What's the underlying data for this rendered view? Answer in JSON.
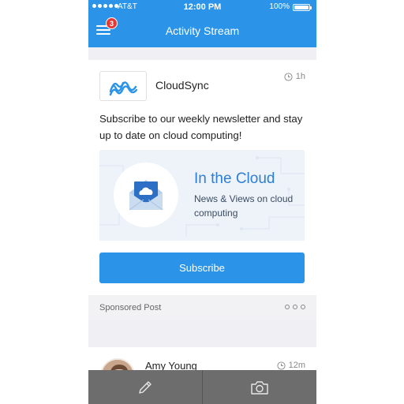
{
  "status_bar": {
    "carrier": "AT&T",
    "time": "12:00 PM",
    "battery": "100%"
  },
  "header": {
    "title": "Activity Stream",
    "notification_count": "3"
  },
  "post": {
    "brand": "CloudSync",
    "time": "1h",
    "text": "Subscribe to our weekly newsletter and stay up to date on cloud computing!",
    "promo": {
      "title": "In the Cloud",
      "subtitle": "News & Views on cloud computing"
    },
    "button_label": "Subscribe",
    "sponsored_label": "Sponsored Post"
  },
  "next_post": {
    "author": "Amy Young",
    "time": "12m"
  },
  "toolbar": {
    "items": [
      {
        "icon": "pencil-icon"
      },
      {
        "icon": "camera-icon"
      }
    ]
  },
  "colors": {
    "primary": "#2b94e8",
    "badge": "#e53935",
    "toolbar": "#6d6d6d"
  }
}
